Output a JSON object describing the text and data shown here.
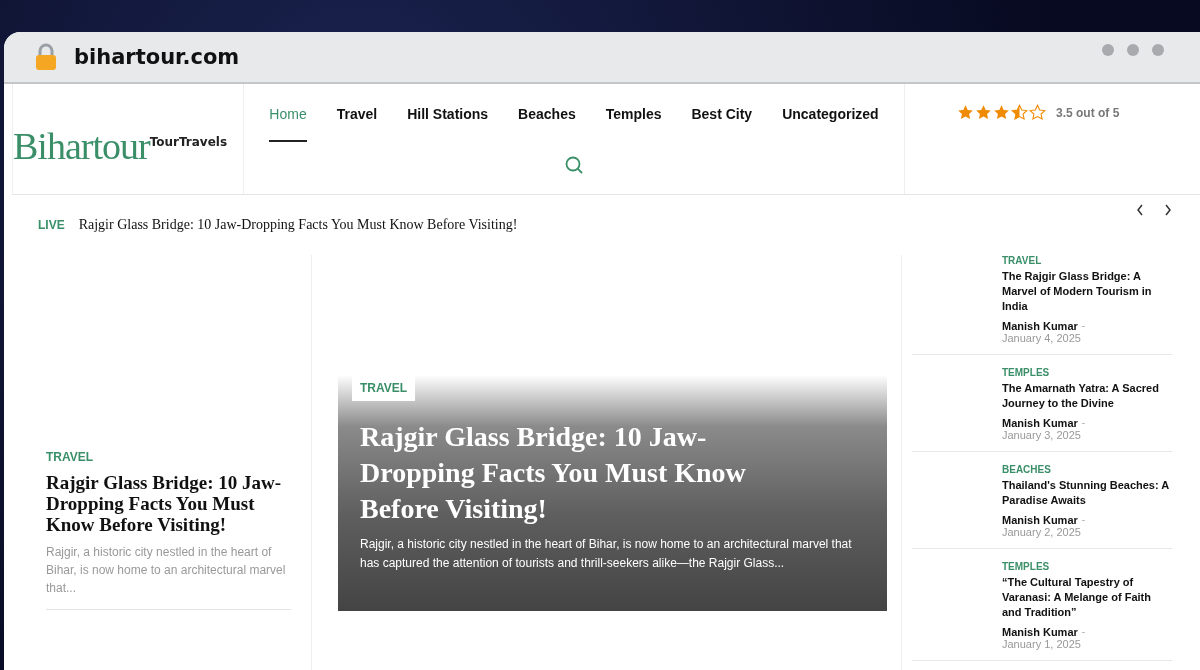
{
  "browser": {
    "url": "bihartour.com"
  },
  "header": {
    "logo": "Bihartour",
    "tagline": "TourTravels"
  },
  "nav": [
    {
      "label": "Home",
      "selected": true
    },
    {
      "label": "Travel",
      "selected": false
    },
    {
      "label": "Hill Stations",
      "selected": false
    },
    {
      "label": "Beaches",
      "selected": false
    },
    {
      "label": "Temples",
      "selected": false
    },
    {
      "label": "Best City",
      "selected": false
    },
    {
      "label": "Uncategorized",
      "selected": false
    }
  ],
  "rating": {
    "stars": 3.5,
    "text": "3.5 out of 5"
  },
  "ticker": {
    "badge": "LIVE",
    "headline": "Rajgir Glass Bridge: 10 Jaw-Dropping Facts You Must Know Before Visiting!"
  },
  "left_post": {
    "category": "TRAVEL",
    "title": "Rajgir Glass Bridge: 10 Jaw-Dropping Facts You Must Know Before Visiting!",
    "excerpt": "Rajgir, a historic city nestled in the heart of Bihar, is now home to an architectural marvel that..."
  },
  "featured": {
    "category": "TRAVEL",
    "title": "Rajgir Glass Bridge: 10 Jaw-Dropping Facts You Must Know Before Visiting!",
    "excerpt": "Rajgir, a historic city nestled in the heart of Bihar, is now home to an architectural marvel that has captured the attention of tourists and thrill-seekers alike—the Rajgir Glass..."
  },
  "sidebar": [
    {
      "category": "TRAVEL",
      "title": "The Rajgir Glass Bridge: A Marvel of Modern Tourism in India",
      "author": "Manish Kumar",
      "separator": "-",
      "date": "January 4, 2025"
    },
    {
      "category": "TEMPLES",
      "title": "The Amarnath Yatra: A Sacred Journey to the Divine",
      "author": "Manish Kumar",
      "separator": "-",
      "date": "January 3, 2025"
    },
    {
      "category": "BEACHES",
      "title": "Thailand's Stunning Beaches: A Paradise Awaits",
      "author": "Manish Kumar",
      "separator": "-",
      "date": "January 2, 2025"
    },
    {
      "category": "TEMPLES",
      "title": "“The Cultural Tapestry of Varanasi: A Melange of Faith and Tradition”",
      "author": "Manish Kumar",
      "separator": "-",
      "date": "January 1, 2025"
    }
  ]
}
